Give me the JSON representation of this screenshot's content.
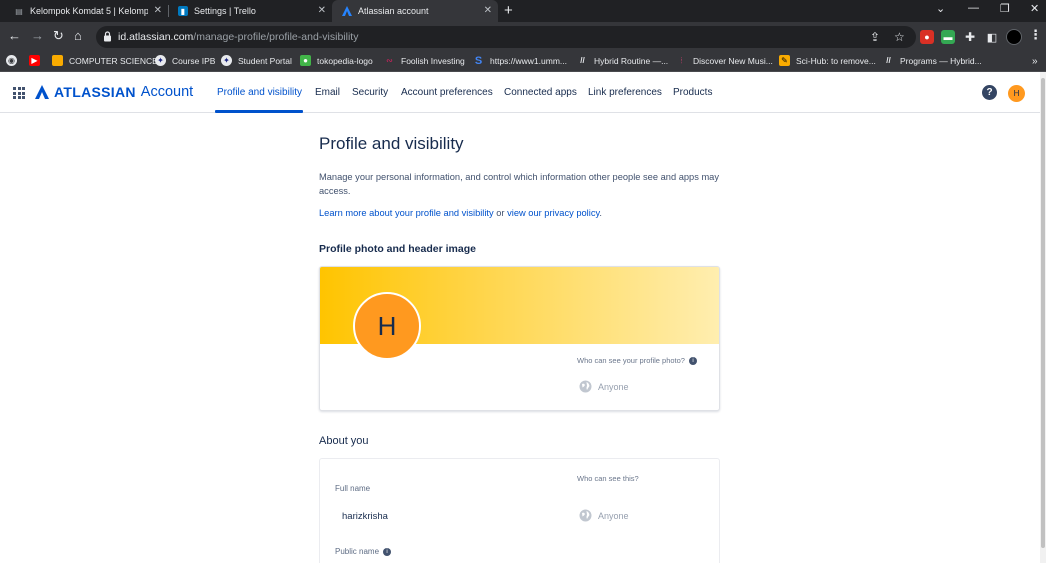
{
  "browser": {
    "tabs": [
      {
        "title": "Kelompok Komdat 5 | Kelompok",
        "icon": "document-icon"
      },
      {
        "title": "Settings | Trello",
        "icon": "trello-icon"
      },
      {
        "title": "Atlassian account",
        "icon": "atlassian-icon",
        "active": true
      }
    ],
    "new_tab": "+",
    "url_host": "id.atlassian.com",
    "url_path": "/manage-profile/profile-and-visibility",
    "bookmarks": [
      "COMPUTER SCIENCE",
      "Course IPB",
      "Student Portal",
      "tokopedia-logo",
      "Foolish Investing",
      "https://www1.umm...",
      "Hybrid Routine —...",
      "Discover New Musi...",
      "Sci-Hub: to remove...",
      "Programs — Hybrid..."
    ]
  },
  "app": {
    "brand": "ATLASSIAN",
    "brand_sub": "Account",
    "nav": [
      "Profile and visibility",
      "Email",
      "Security",
      "Account preferences",
      "Connected apps",
      "Link preferences",
      "Products"
    ],
    "help": "?",
    "user_initial": "H"
  },
  "page": {
    "title": "Profile and visibility",
    "intro": "Manage your personal information, and control which information other people see and apps may access.",
    "learn_link": "Learn more about your profile and visibility",
    "learn_or": " or ",
    "privacy_link": "view our privacy policy",
    "learn_end": "."
  },
  "photo_section": {
    "heading": "Profile photo and header image",
    "avatar_initial": "H",
    "who_label": "Who can see your profile photo?",
    "visibility": "Anyone"
  },
  "about_section": {
    "heading": "About you",
    "who_label": "Who can see this?",
    "full_name_label": "Full name",
    "full_name_value": "harizkrisha",
    "full_name_visibility": "Anyone",
    "public_name_label": "Public name"
  },
  "colors": {
    "accent": "#0052cc",
    "avatar": "#ff991f",
    "header_gradient_start": "#ffc400",
    "header_gradient_end": "#ffeeb0"
  }
}
